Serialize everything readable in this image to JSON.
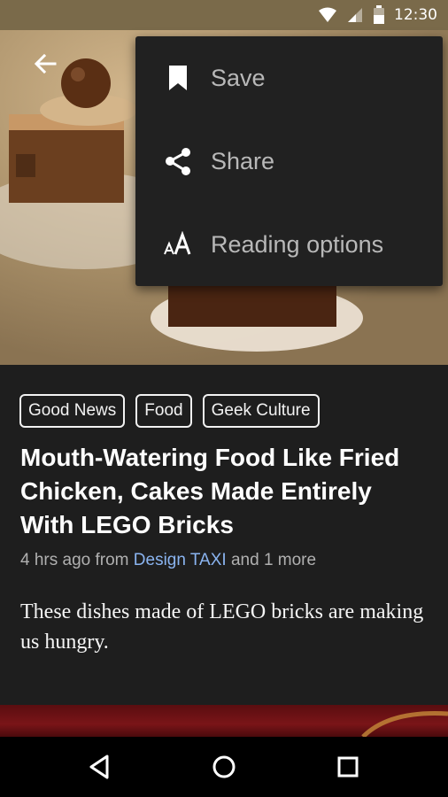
{
  "status_bar": {
    "time": "12:30",
    "icons": [
      "wifi-icon",
      "cell-signal-icon",
      "battery-icon"
    ]
  },
  "hero": {
    "back_icon": "arrow-back-icon"
  },
  "menu": {
    "items": [
      {
        "label": "Save",
        "icon": "bookmark-icon"
      },
      {
        "label": "Share",
        "icon": "share-icon"
      },
      {
        "label": "Reading options",
        "icon": "text-size-icon"
      }
    ]
  },
  "article": {
    "tags": [
      "Good News",
      "Food",
      "Geek Culture"
    ],
    "headline": "Mouth-Watering Food Like Fried Chicken, Cakes Made Entirely With LEGO Bricks",
    "meta": {
      "time": "4 hrs ago from ",
      "source": "Design TAXI",
      "more": " and 1 more"
    },
    "summary": "These dishes made of LEGO bricks are making us hungry."
  },
  "nav_bar": {
    "buttons": [
      "back-triangle-icon",
      "home-circle-icon",
      "recents-square-icon"
    ]
  },
  "colors": {
    "background": "#1e1e1e",
    "menu_background": "#212121",
    "link": "#8ab4f0",
    "menu_text": "#b8b8b8"
  }
}
